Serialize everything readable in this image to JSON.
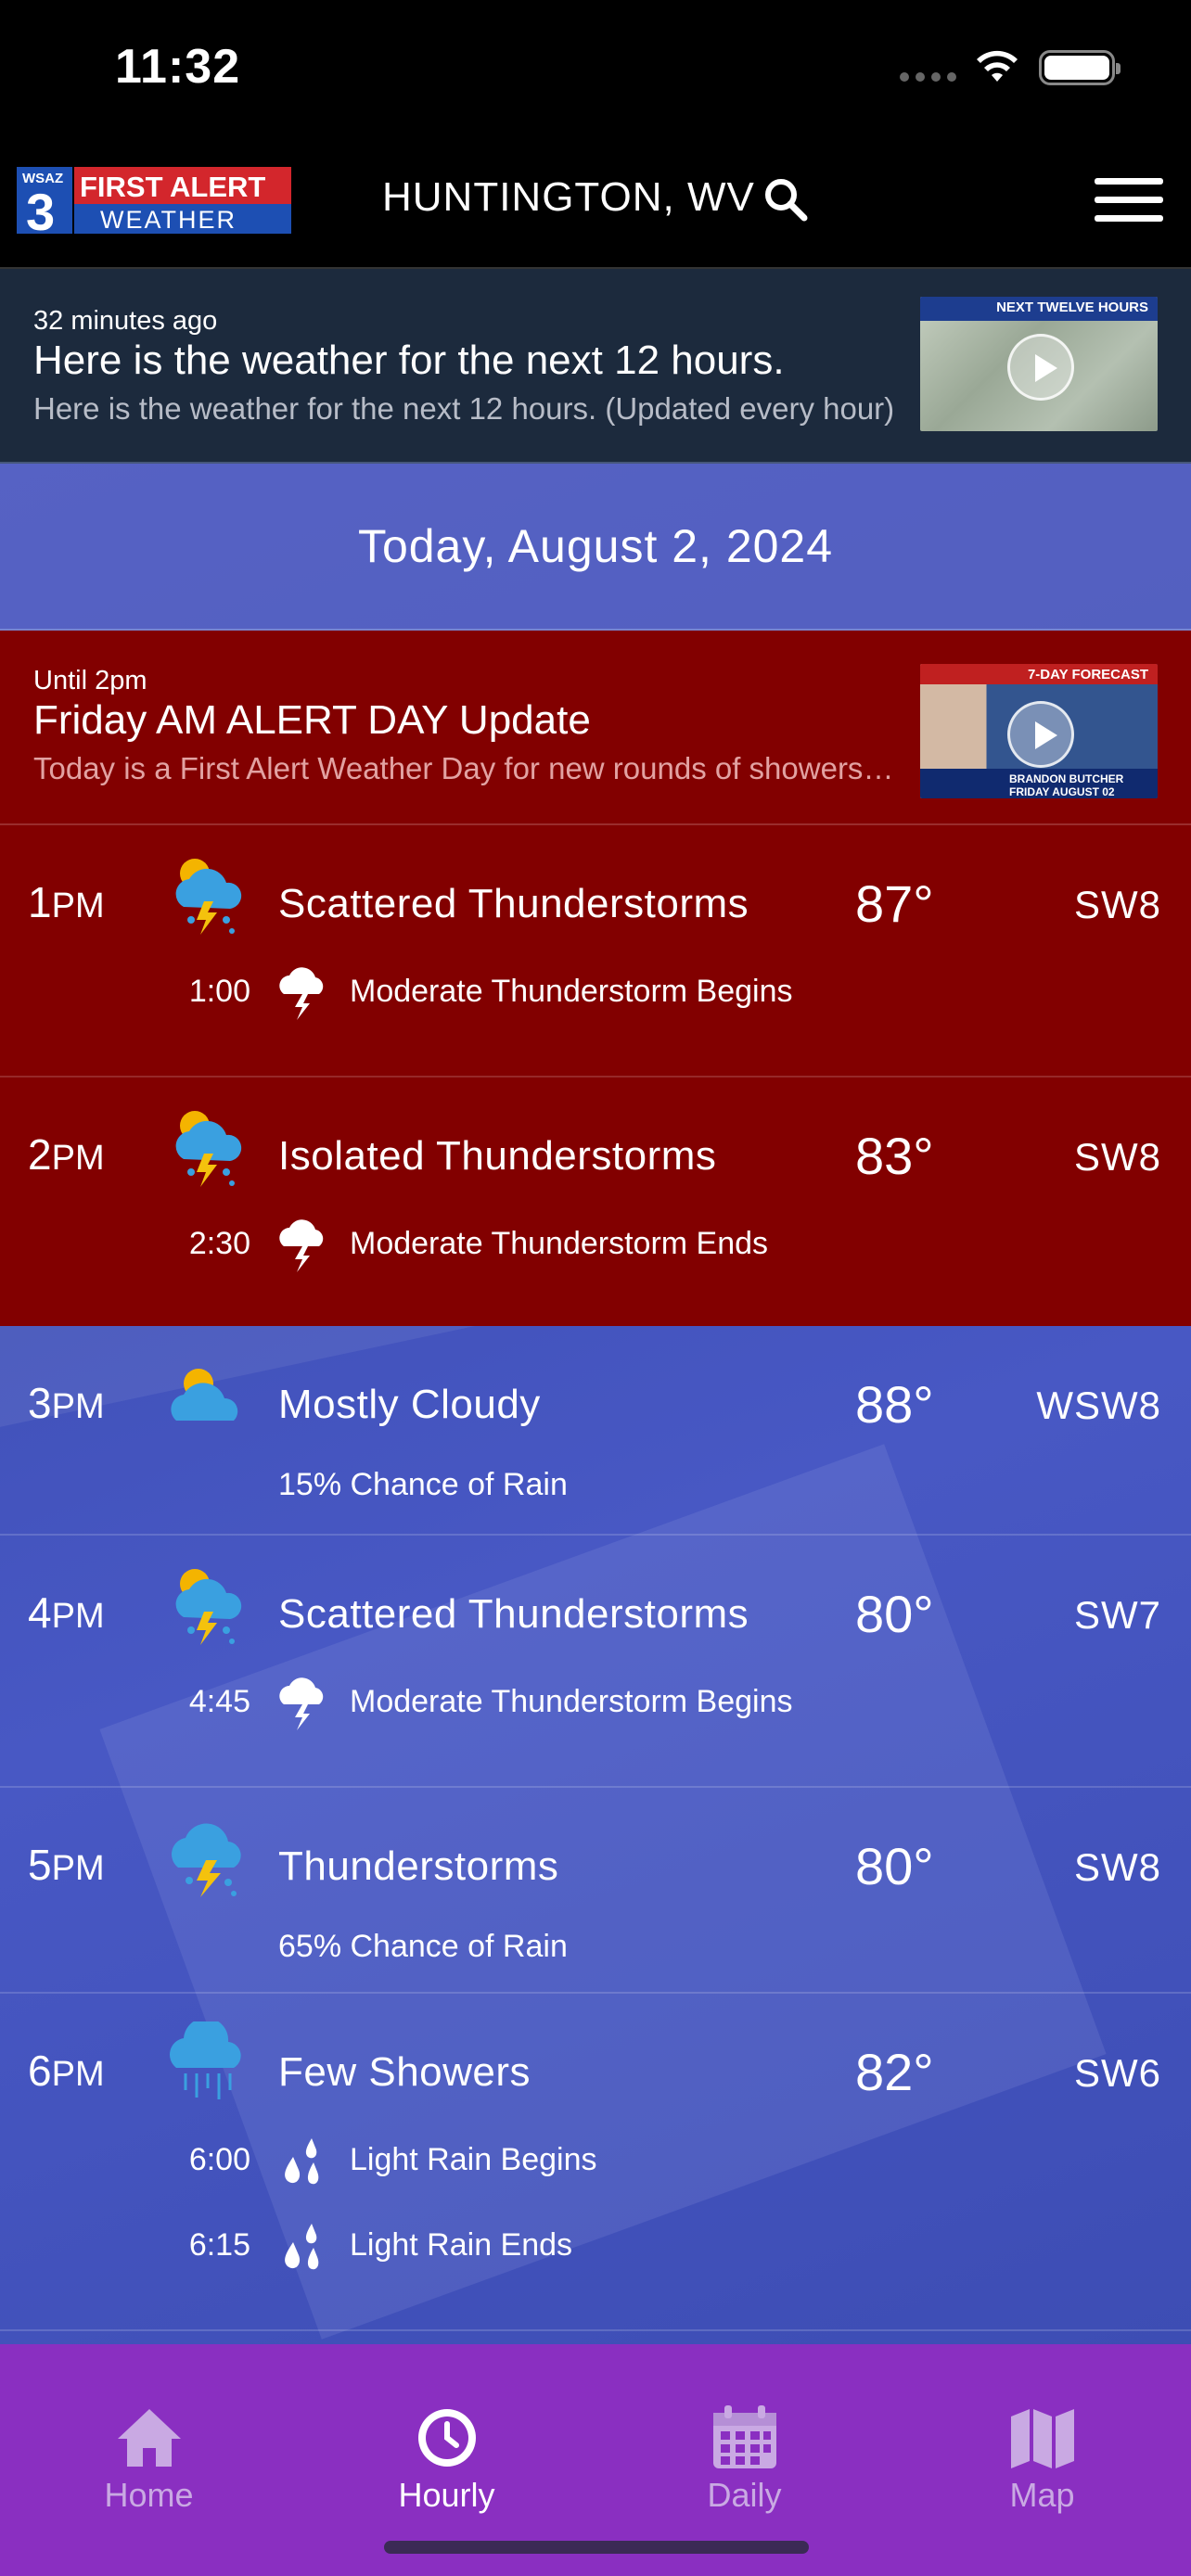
{
  "status": {
    "time": "11:32"
  },
  "header": {
    "logo": {
      "station": "WSAZ",
      "channel": "3",
      "line1": "FIRST ALERT",
      "line2": "WEATHER"
    },
    "location": "HUNTINGTON, WV",
    "search_icon": "search-icon",
    "menu_icon": "hamburger-menu-icon"
  },
  "news": {
    "meta": "32 minutes ago",
    "title": "Here is the weather for the next 12 hours.",
    "description": "Here is the weather for the next 12 hours. (Updated every hour)",
    "thumbnail_label": "NEXT TWELVE HOURS"
  },
  "date_label": "Today, August 2, 2024",
  "alert": {
    "meta": "Until 2pm",
    "title": "Friday AM ALERT DAY Update",
    "description": "Today is a First Alert Weather Day for new rounds of showers and storms.",
    "thumbnail_label": "7-DAY FORECAST",
    "thumbnail_footer": "BRANDON BUTCHER  FRIDAY AUGUST 02",
    "colors": {
      "background": "#820000"
    }
  },
  "hours": [
    {
      "hour": "1",
      "ampm": "PM",
      "condition": "Scattered Thunderstorms",
      "temp": "87°",
      "wind": "SW8",
      "icon": "sun-cloud-storm-icon",
      "events": [
        {
          "time": "1:00",
          "text": "Moderate Thunderstorm Begins",
          "icon": "thunderstorm-icon"
        }
      ]
    },
    {
      "hour": "2",
      "ampm": "PM",
      "condition": "Isolated Thunderstorms",
      "temp": "83°",
      "wind": "SW8",
      "icon": "sun-cloud-storm-icon",
      "events": [
        {
          "time": "2:30",
          "text": "Moderate Thunderstorm Ends",
          "icon": "thunderstorm-icon"
        }
      ]
    },
    {
      "hour": "3",
      "ampm": "PM",
      "condition": "Mostly Cloudy",
      "temp": "88°",
      "wind": "WSW8",
      "icon": "sun-cloud-icon",
      "chance": "15% Chance of Rain"
    },
    {
      "hour": "4",
      "ampm": "PM",
      "condition": "Scattered Thunderstorms",
      "temp": "80°",
      "wind": "SW7",
      "icon": "sun-cloud-storm-icon",
      "events": [
        {
          "time": "4:45",
          "text": "Moderate Thunderstorm Begins",
          "icon": "thunderstorm-icon"
        }
      ]
    },
    {
      "hour": "5",
      "ampm": "PM",
      "condition": "Thunderstorms",
      "temp": "80°",
      "wind": "SW8",
      "icon": "cloud-storm-icon",
      "chance": "65% Chance of Rain"
    },
    {
      "hour": "6",
      "ampm": "PM",
      "condition": "Few Showers",
      "temp": "82°",
      "wind": "SW6",
      "icon": "cloud-rain-icon",
      "events": [
        {
          "time": "6:00",
          "text": "Light Rain Begins",
          "icon": "raindrops-icon"
        },
        {
          "time": "6:15",
          "text": "Light Rain Ends",
          "icon": "raindrops-icon"
        }
      ]
    }
  ],
  "tabs": [
    {
      "label": "Home",
      "icon": "home-icon",
      "active": false
    },
    {
      "label": "Hourly",
      "icon": "clock-icon",
      "active": true
    },
    {
      "label": "Daily",
      "icon": "calendar-icon",
      "active": false
    },
    {
      "label": "Map",
      "icon": "map-icon",
      "active": false
    }
  ],
  "colors": {
    "tabbar": "#8a2fc1",
    "alert": "#820000",
    "header": "#000000",
    "sun": "#f4b400",
    "bolt": "#f4c20d",
    "cloud_blue": "#3aa0e0"
  }
}
